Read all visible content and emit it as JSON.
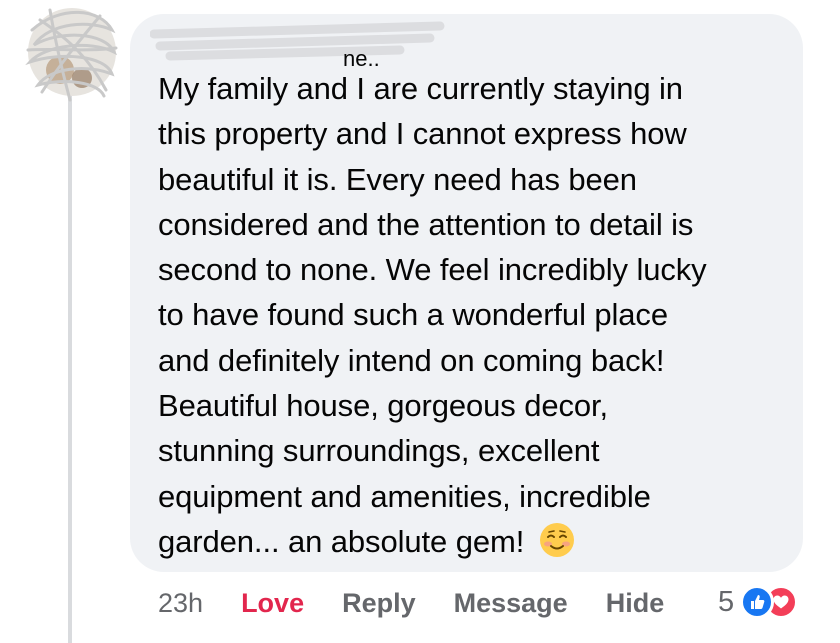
{
  "comment": {
    "author_partial": "ne..",
    "text": "My family and I are currently staying in this property and I cannot express how beautiful it is. Every need has been considered and the attention to detail is second to none. We feel incredibly lucky to have found such a wonderful place and definitely intend on coming back! Beautiful house, gorgeous decor, stunning surroundings, excellent equipment and amenities, incredible garden... an absolute gem!",
    "text_lines": [
      "My family and I are currently staying in",
      "this property and I cannot express how",
      "beautiful it is. Every need has been",
      "considered and the attention to detail is",
      "second to none. We feel incredibly lucky",
      "to have found such a wonderful place",
      "and definitely intend on coming back!",
      "Beautiful house, gorgeous decor,",
      "stunning surroundings, excellent",
      "equipment and amenities, incredible",
      "garden... an absolute gem!"
    ],
    "emoji": "smiling-face-icon"
  },
  "actions": {
    "timestamp": "23h",
    "love_label": "Love",
    "reply_label": "Reply",
    "message_label": "Message",
    "hide_label": "Hide"
  },
  "reactions": {
    "count": "5",
    "types": [
      "like-icon",
      "heart-icon"
    ]
  },
  "colors": {
    "bubble": "#f0f2f5",
    "text": "#050505",
    "meta": "#65676b",
    "love": "#e2264d",
    "like": "#1877f2",
    "heart": "#f33e58"
  }
}
